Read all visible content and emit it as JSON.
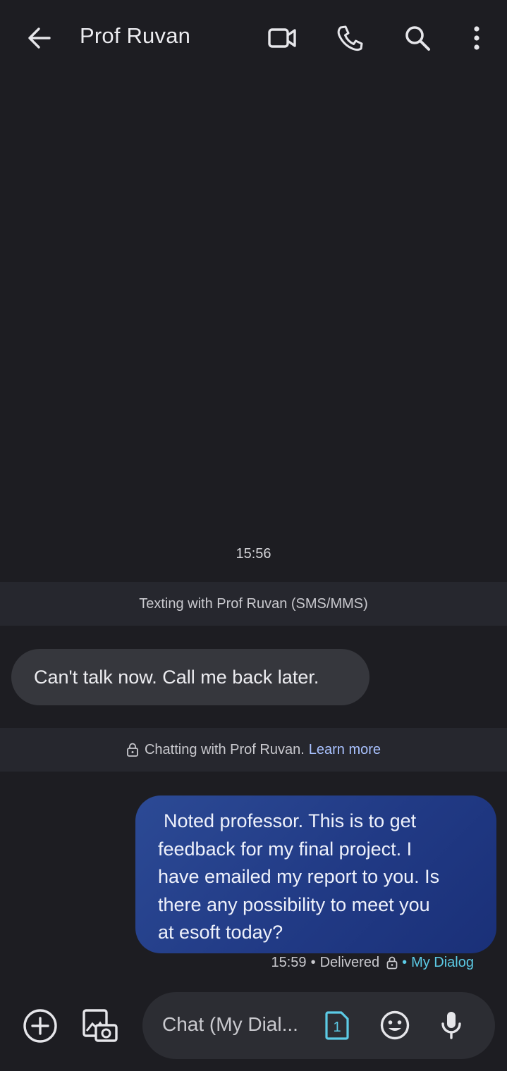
{
  "header": {
    "title": "Prof Ruvan",
    "icons": [
      "back-arrow-icon",
      "video-call-icon",
      "phone-icon",
      "search-icon",
      "more-vert-icon"
    ]
  },
  "conversation": {
    "timestamp": "15:56",
    "sms_notice": "Texting with Prof Ruvan (SMS/MMS)",
    "incoming_message": "Can't talk now. Call me back later.",
    "rcs_notice": "Chatting with Prof Ruvan.",
    "learn_more": "Learn more",
    "outgoing_message": {
      "lines": [
        "Noted professor. This is to get",
        "feedback for my final project. I",
        "have emailed my report to you. Is",
        "there any possibility to meet you",
        "at esoft today?"
      ],
      "time": "15:59",
      "status": "Delivered",
      "carrier": "My Dialog"
    }
  },
  "composer": {
    "placeholder": "Chat (My Dial...",
    "sim_number": "1"
  },
  "colors": {
    "background": "#1d1d22",
    "band": "#26272e",
    "incoming_bubble": "#36373d",
    "outgoing_bubble": "#243f8c",
    "link": "#a9c2ff",
    "carrier": "#5ccbe6"
  }
}
